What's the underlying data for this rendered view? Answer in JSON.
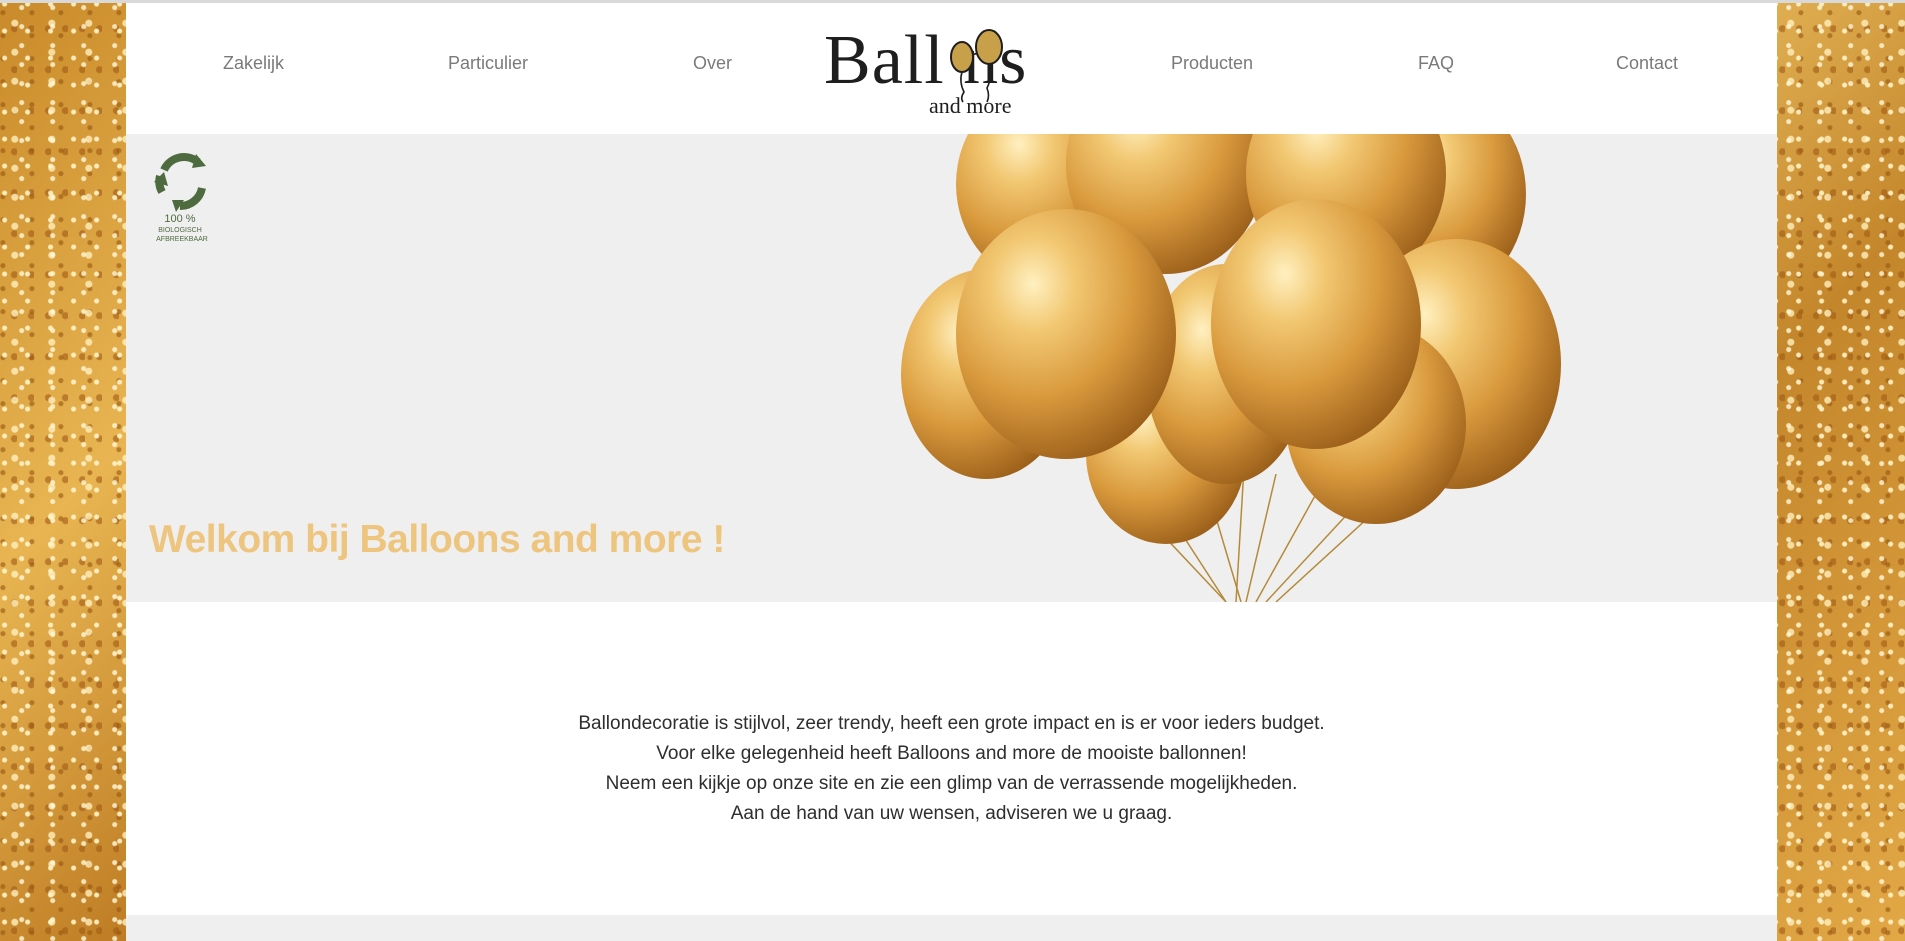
{
  "nav": {
    "items": [
      {
        "label": "Zakelijk"
      },
      {
        "label": "Particulier"
      },
      {
        "label": "Over"
      },
      {
        "label": "Producten"
      },
      {
        "label": "FAQ"
      },
      {
        "label": "Contact"
      }
    ]
  },
  "logo": {
    "text_main": "Ball  ns",
    "text_sub": "and more",
    "balloon_color": "#c9a04a"
  },
  "badge": {
    "icon": "recycle-icon",
    "line1": "100 %",
    "line2": "BIOLOGISCH",
    "line3": "AFBREEKBAAR",
    "color": "#4e6b3f"
  },
  "hero": {
    "title": "Welkom bij Balloons and more !",
    "title_color": "#eec57e"
  },
  "intro": {
    "lines": [
      "Ballondecoratie is stijlvol, zeer trendy, heeft een grote impact en is er voor ieders budget.",
      "Voor elke gelegenheid heeft Balloons and more de mooiste ballonnen!",
      "Neem een kijkje op onze site en zie een glimp van de verrassende mogelijkheden.",
      "Aan de hand van uw wensen, adviseren we u graag."
    ]
  }
}
